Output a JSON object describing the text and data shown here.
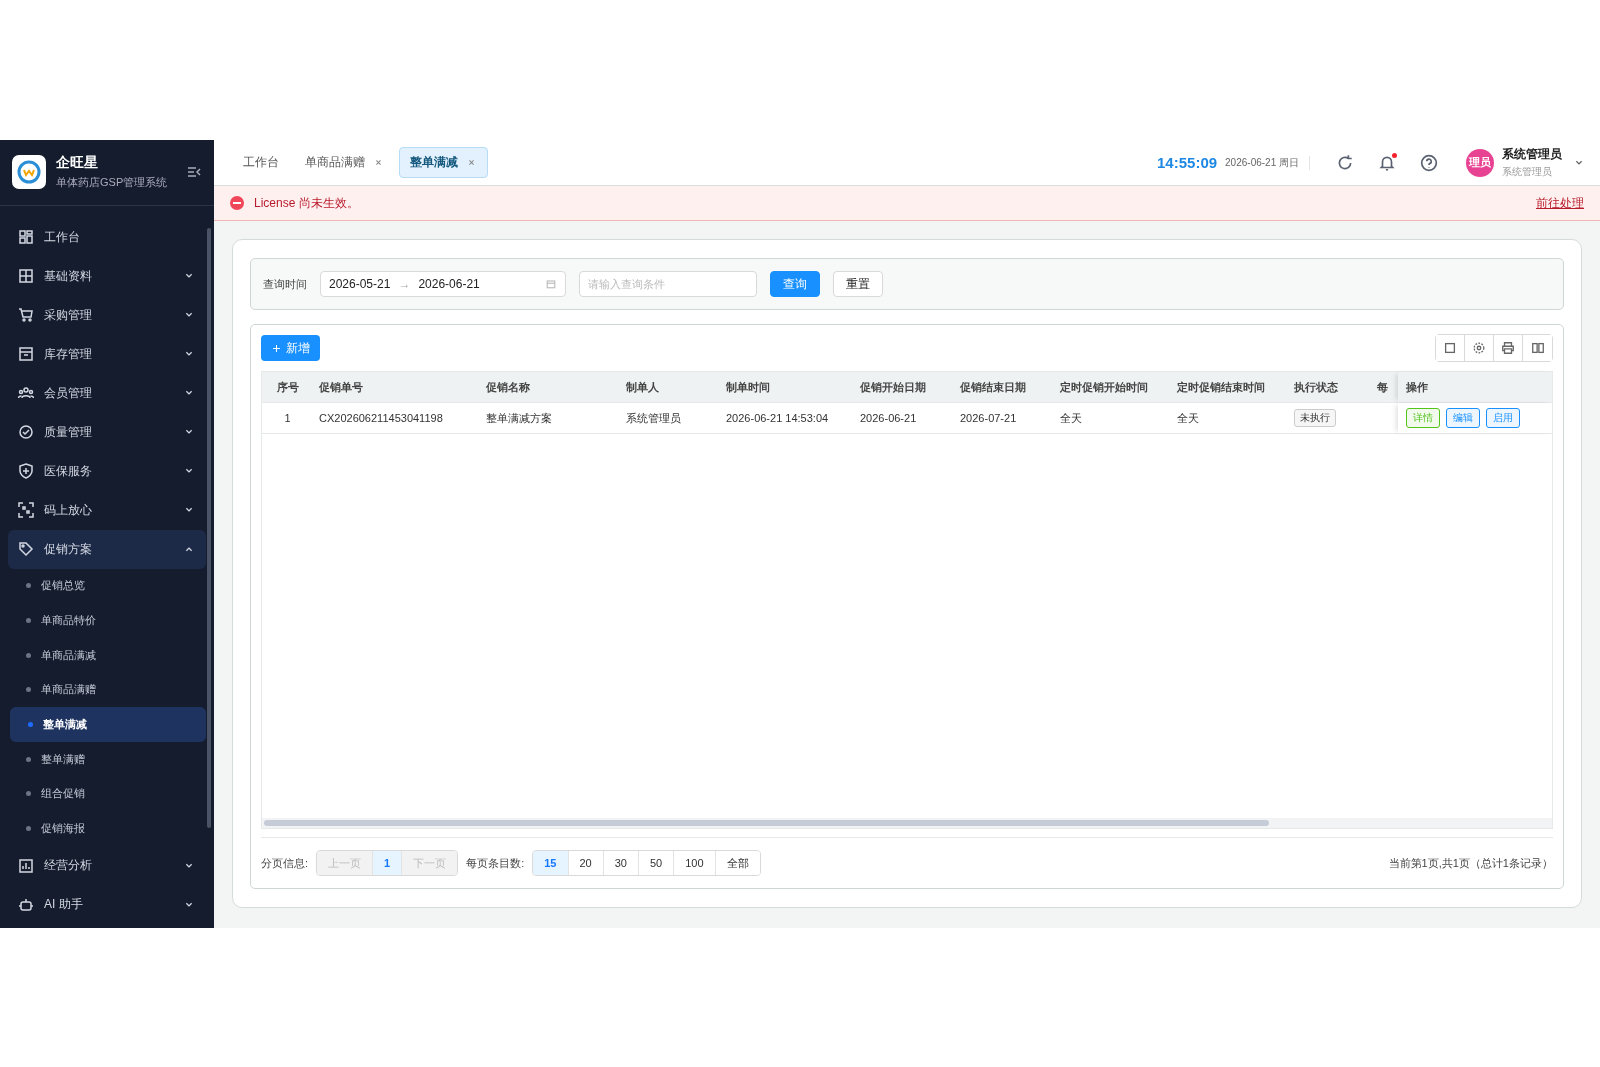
{
  "brand": {
    "name": "企旺星",
    "subtitle": "单体药店GSP管理系统"
  },
  "sidebar": {
    "items": [
      {
        "label": "工作台",
        "kind": "link"
      },
      {
        "label": "基础资料",
        "kind": "group",
        "expanded": false
      },
      {
        "label": "采购管理",
        "kind": "group",
        "expanded": false
      },
      {
        "label": "库存管理",
        "kind": "group",
        "expanded": false
      },
      {
        "label": "会员管理",
        "kind": "group",
        "expanded": false
      },
      {
        "label": "质量管理",
        "kind": "group",
        "expanded": false
      },
      {
        "label": "医保服务",
        "kind": "group",
        "expanded": false
      },
      {
        "label": "码上放心",
        "kind": "group",
        "expanded": false
      },
      {
        "label": "促销方案",
        "kind": "group",
        "expanded": true,
        "children": [
          {
            "label": "促销总览",
            "selected": false
          },
          {
            "label": "单商品特价",
            "selected": false
          },
          {
            "label": "单商品满减",
            "selected": false
          },
          {
            "label": "单商品满赠",
            "selected": false
          },
          {
            "label": "整单满减",
            "selected": true
          },
          {
            "label": "整单满赠",
            "selected": false
          },
          {
            "label": "组合促销",
            "selected": false
          },
          {
            "label": "促销海报",
            "selected": false
          }
        ]
      },
      {
        "label": "经营分析",
        "kind": "group",
        "expanded": false
      },
      {
        "label": "AI 助手",
        "kind": "group",
        "expanded": false
      }
    ]
  },
  "tabs": [
    {
      "label": "工作台",
      "closable": false,
      "selected": false
    },
    {
      "label": "单商品满赠",
      "closable": true,
      "selected": false
    },
    {
      "label": "整单满减",
      "closable": true,
      "selected": true
    }
  ],
  "header": {
    "time": "14:55:09",
    "date": "2026-06-21 周日",
    "notification_dot": true,
    "avatar": "理员",
    "user": "系统管理员",
    "role": "系统管理员"
  },
  "alert": {
    "message": "License 尚未生效。",
    "link": "前往处理"
  },
  "filter": {
    "label": "查询时间",
    "start": "2026-05-21",
    "arrow": "→",
    "end": "2026-06-21",
    "placeholder": "请输入查询条件",
    "search": "查询",
    "reset": "重置"
  },
  "toolbar": {
    "add": "新增"
  },
  "table": {
    "columns": [
      "序号",
      "促销单号",
      "促销名称",
      "制单人",
      "制单时间",
      "促销开始日期",
      "促销结束日期",
      "定时促销开始时间",
      "定时促销结束时间",
      "执行状态",
      "每",
      "操作"
    ],
    "rows": [
      {
        "cells": [
          "1",
          "CX202606211453041198",
          "整单满减方案",
          "系统管理员",
          "2026-06-21 14:53:04",
          "2026-06-21",
          "2026-07-21",
          "全天",
          "全天"
        ],
        "status": "未执行",
        "actions": [
          {
            "label": "详情",
            "color": "#52c41a"
          },
          {
            "label": "编辑",
            "color": "#1890ff"
          },
          {
            "label": "启用",
            "color": "#1890ff"
          }
        ]
      }
    ]
  },
  "pagination": {
    "label": "分页信息:",
    "prev": "上一页",
    "prev_disabled": true,
    "pages": [
      {
        "label": "1",
        "selected": true
      }
    ],
    "next": "下一页",
    "next_disabled": true,
    "size_label": "每页条目数:",
    "sizes": [
      {
        "label": "15",
        "selected": true
      },
      {
        "label": "20",
        "selected": false
      },
      {
        "label": "30",
        "selected": false
      },
      {
        "label": "50",
        "selected": false
      },
      {
        "label": "100",
        "selected": false
      },
      {
        "label": "全部",
        "selected": false
      }
    ],
    "summary": "当前第1页,共1页（总计1条记录）"
  }
}
